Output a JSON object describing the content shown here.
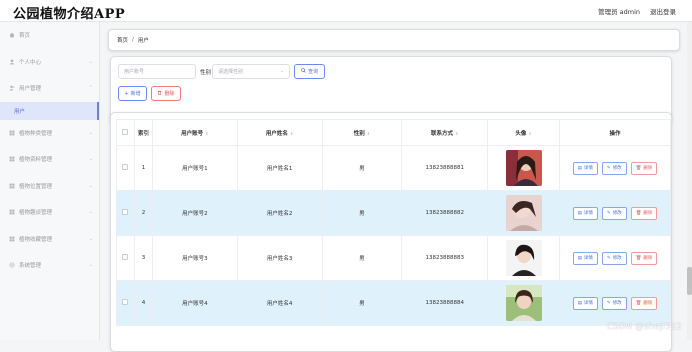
{
  "app": {
    "title": "公园植物介绍APP",
    "admin_label": "管理员 admin",
    "logout_label": "退出登录"
  },
  "sidebar": {
    "items": [
      {
        "label": "首页",
        "icon": "home-icon",
        "has_chevron": false
      },
      {
        "label": "个人中心",
        "icon": "user-icon",
        "has_chevron": true
      },
      {
        "label": "用户管理",
        "icon": "users-icon",
        "has_chevron": true,
        "expanded": true
      },
      {
        "label": "植物种类管理",
        "icon": "grid-icon",
        "has_chevron": true
      },
      {
        "label": "植物资料管理",
        "icon": "grid-icon",
        "has_chevron": true
      },
      {
        "label": "植物位置管理",
        "icon": "grid-icon",
        "has_chevron": true
      },
      {
        "label": "植物趣谈管理",
        "icon": "grid-icon",
        "has_chevron": true
      },
      {
        "label": "植物收藏管理",
        "icon": "grid-icon",
        "has_chevron": true
      },
      {
        "label": "系统管理",
        "icon": "gear-icon",
        "has_chevron": true
      }
    ],
    "active_sub": "用户"
  },
  "breadcrumb": {
    "home": "首页",
    "separator": "/",
    "current": "用户"
  },
  "filters": {
    "account_placeholder": "用户账号",
    "gender_label": "性别",
    "gender_placeholder": "请选择性别",
    "search_label": "查询",
    "add_label": "新增",
    "delete_label": "删除"
  },
  "table": {
    "headers": {
      "index": "索引",
      "account": "用户账号",
      "name": "用户姓名",
      "gender": "性别",
      "phone": "联系方式",
      "avatar": "头像",
      "actions": "操作"
    },
    "action_labels": {
      "detail": "详情",
      "edit": "修改",
      "delete": "删除"
    },
    "rows": [
      {
        "index": "1",
        "account": "用户账号1",
        "name": "用户姓名1",
        "gender": "男",
        "phone": "13823888881"
      },
      {
        "index": "2",
        "account": "用户账号2",
        "name": "用户姓名2",
        "gender": "男",
        "phone": "13823888882"
      },
      {
        "index": "3",
        "account": "用户账号3",
        "name": "用户姓名3",
        "gender": "男",
        "phone": "13823888883"
      },
      {
        "index": "4",
        "account": "用户账号4",
        "name": "用户姓名4",
        "gender": "男",
        "phone": "13823888884"
      }
    ]
  },
  "watermark": "CSDN @sheji322",
  "colors": {
    "accent": "#4d72e8",
    "danger": "#e85858",
    "stripe": "#dff1fb",
    "active_menu_bg": "#dfe5fb"
  }
}
